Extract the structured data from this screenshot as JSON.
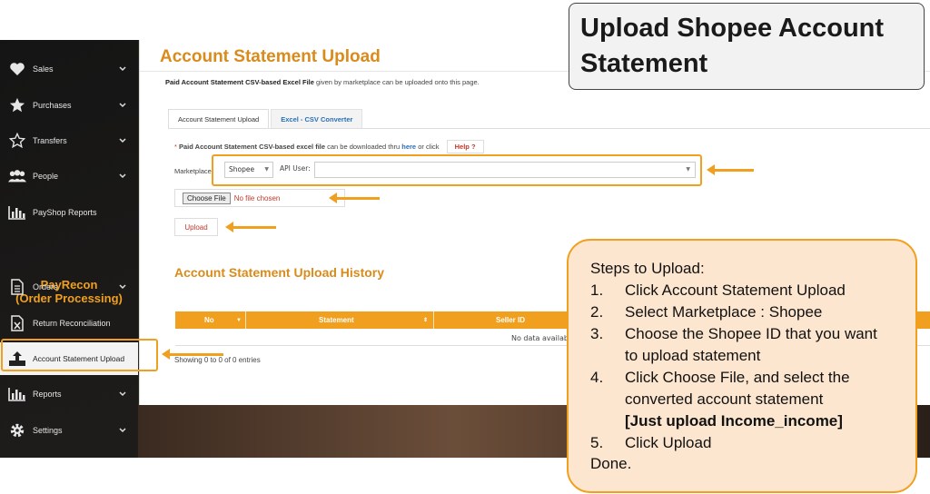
{
  "callout_title": {
    "line1": "Upload Shopee Account",
    "line2": "Statement"
  },
  "sidebar": {
    "items": [
      {
        "label": "Sales",
        "icon": "heart-icon"
      },
      {
        "label": "Purchases",
        "icon": "star-icon"
      },
      {
        "label": "Transfers",
        "icon": "star-outline-icon"
      },
      {
        "label": "People",
        "icon": "people-icon"
      },
      {
        "label": "PayShop Reports",
        "icon": "bar-chart-icon"
      },
      {
        "label": "Orders",
        "icon": "document-icon"
      },
      {
        "label": "Return Reconciliation",
        "icon": "excel-file-icon"
      },
      {
        "label": "Account Statement Upload",
        "icon": "upload-icon"
      },
      {
        "label": "Reports",
        "icon": "bar-chart-icon"
      },
      {
        "label": "Settings",
        "icon": "gear-icon"
      }
    ],
    "brand_line1": "PayRecon",
    "brand_line2": "(Order Processing)"
  },
  "main": {
    "title": "Account Statement Upload",
    "subtitle_bold": "Paid Account Statement CSV-based Excel File",
    "subtitle_rest": " given by marketplace can be uploaded onto this page.",
    "tabs": [
      {
        "label": "Account Statement Upload",
        "active": true
      },
      {
        "label": "Excel - CSV Converter",
        "active": false
      }
    ],
    "note_star": "*",
    "note_bold": " Paid Account Statement CSV-based excel file",
    "note_mid": " can be downloaded thru ",
    "note_link": "here",
    "note_end": " or click",
    "help_label": "Help ?",
    "marketplace_label": "Marketplace:",
    "marketplace_value": "Shopee",
    "api_user_label": "API User:",
    "api_user_value": "",
    "choose_file_label": "Choose File",
    "no_file_text": "No file chosen",
    "upload_label": "Upload",
    "history_title": "Account Statement Upload History",
    "table": {
      "columns": [
        "No",
        "Statement",
        "Seller ID"
      ],
      "no_data": "No data availab",
      "showing": "Showing 0 to 0 of 0 entries"
    }
  },
  "steps": {
    "heading": "Steps to Upload:",
    "items": [
      {
        "n": "1.",
        "text": "Click Account Statement Upload"
      },
      {
        "n": "2.",
        "text": "Select Marketplace : Shopee"
      },
      {
        "n": "3.",
        "text": "Choose the Shopee ID that you want to upload statement"
      },
      {
        "n": "4.",
        "text": "Click Choose File, and select the converted account statement",
        "bold": "[Just upload Income_income]"
      },
      {
        "n": "5.",
        "text": "Click Upload"
      }
    ],
    "done": "Done."
  },
  "colors": {
    "accent": "#f0a01e",
    "title": "#d98b1c",
    "link": "#2a6fb5",
    "danger": "#c0392b"
  }
}
